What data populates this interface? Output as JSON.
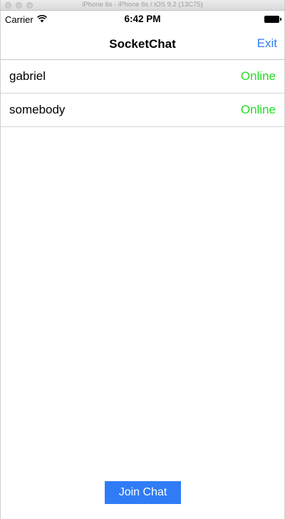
{
  "simulator": {
    "title": "iPhone 6s - iPhone 6s / iOS 9.2 (13C75)"
  },
  "statusbar": {
    "carrier": "Carrier",
    "time": "6:42 PM",
    "wifi_icon": "wifi-icon",
    "battery_icon": "battery-icon"
  },
  "navbar": {
    "title": "SocketChat",
    "exit_label": "Exit"
  },
  "users": [
    {
      "name": "gabriel",
      "status": "Online",
      "status_color": "#22dd22"
    },
    {
      "name": "somebody",
      "status": "Online",
      "status_color": "#22dd22"
    }
  ],
  "footer": {
    "join_label": "Join Chat"
  },
  "colors": {
    "accent": "#2f7cf6",
    "online": "#22dd22"
  }
}
